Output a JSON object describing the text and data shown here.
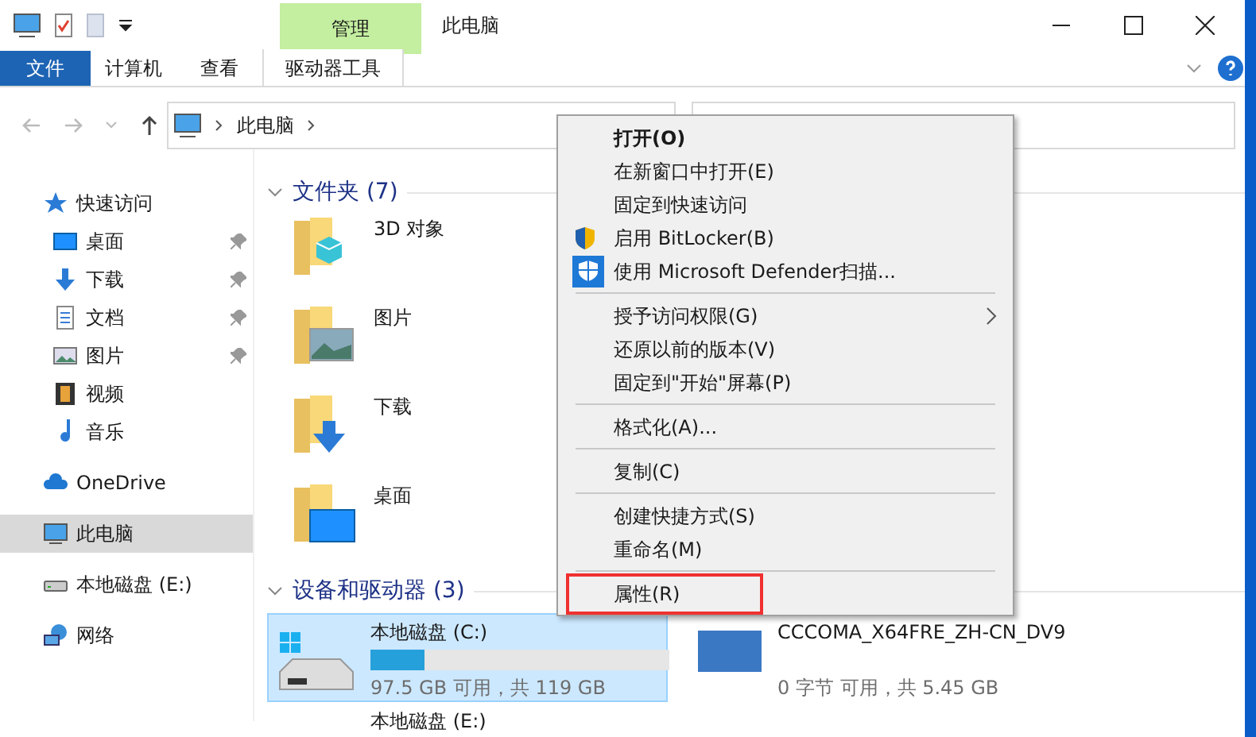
{
  "window": {
    "title": "此电脑",
    "context_tab": "管理"
  },
  "ribbon": {
    "tabs": [
      {
        "label": "文件",
        "selected": true,
        "kind": "file"
      },
      {
        "label": "计算机",
        "selected": false,
        "kind": "tab"
      },
      {
        "label": "查看",
        "selected": false,
        "kind": "tab"
      },
      {
        "label": "驱动器工具",
        "selected": false,
        "kind": "context"
      }
    ]
  },
  "address_bar": {
    "path": "此电脑"
  },
  "sidebar": {
    "items": [
      {
        "label": "快速访问",
        "kind": "star",
        "pinned": false,
        "selected": false,
        "children": [
          {
            "label": "桌面",
            "kind": "desktop",
            "pinned": true,
            "selected": false
          },
          {
            "label": "下载",
            "kind": "download",
            "pinned": true,
            "selected": false
          },
          {
            "label": "文档",
            "kind": "document",
            "pinned": true,
            "selected": false
          },
          {
            "label": "图片",
            "kind": "picture",
            "pinned": true,
            "selected": false
          },
          {
            "label": "视频",
            "kind": "video",
            "pinned": false,
            "selected": false
          },
          {
            "label": "音乐",
            "kind": "music",
            "pinned": false,
            "selected": false
          }
        ]
      },
      {
        "label": "OneDrive",
        "kind": "cloud",
        "pinned": false,
        "selected": false
      },
      {
        "label": "此电脑",
        "kind": "pc",
        "pinned": false,
        "selected": true
      },
      {
        "label": "本地磁盘 (E:)",
        "kind": "drive",
        "pinned": false,
        "selected": false
      },
      {
        "label": "网络",
        "kind": "network",
        "pinned": false,
        "selected": false
      }
    ]
  },
  "folders": {
    "heading": "文件夹 (7)",
    "items": [
      {
        "name": "3D 对象",
        "kind": "cube"
      },
      {
        "name": "图片",
        "kind": "picture"
      },
      {
        "name": "下载",
        "kind": "download"
      },
      {
        "name": "桌面",
        "kind": "desktop"
      }
    ]
  },
  "drives": {
    "heading": "设备和驱动器 (3)",
    "items": [
      {
        "name": "本地磁盘 (C:)",
        "space": "97.5 GB 可用，共 119 GB",
        "level": 0.18,
        "selected": true,
        "kind": "system"
      },
      {
        "name": "CCCOMA_X64FRE_ZH-CN_DV9",
        "space": "0 字节 可用，共 5.45 GB",
        "selected": false,
        "kind": "dvd"
      },
      {
        "name": "本地磁盘 (E:)",
        "selected": false,
        "kind": "drive"
      }
    ]
  },
  "context_menu": {
    "groups": [
      [
        {
          "label": "打开(O)",
          "bold": true
        },
        {
          "label": "在新窗口中打开(E)"
        },
        {
          "label": "固定到快速访问"
        },
        {
          "label": "启用 BitLocker(B)",
          "kind": "shield"
        },
        {
          "label": "使用 Microsoft Defender扫描...",
          "kind": "defender"
        }
      ],
      [
        {
          "label": "授予访问权限(G)",
          "submenu": true
        },
        {
          "label": "还原以前的版本(V)"
        },
        {
          "label": "固定到\"开始\"屏幕(P)"
        }
      ],
      [
        {
          "label": "格式化(A)..."
        }
      ],
      [
        {
          "label": "复制(C)"
        }
      ],
      [
        {
          "label": "创建快捷方式(S)"
        },
        {
          "label": "重命名(M)"
        }
      ],
      [
        {
          "label": "属性(R)",
          "highlighted": true
        }
      ]
    ]
  }
}
